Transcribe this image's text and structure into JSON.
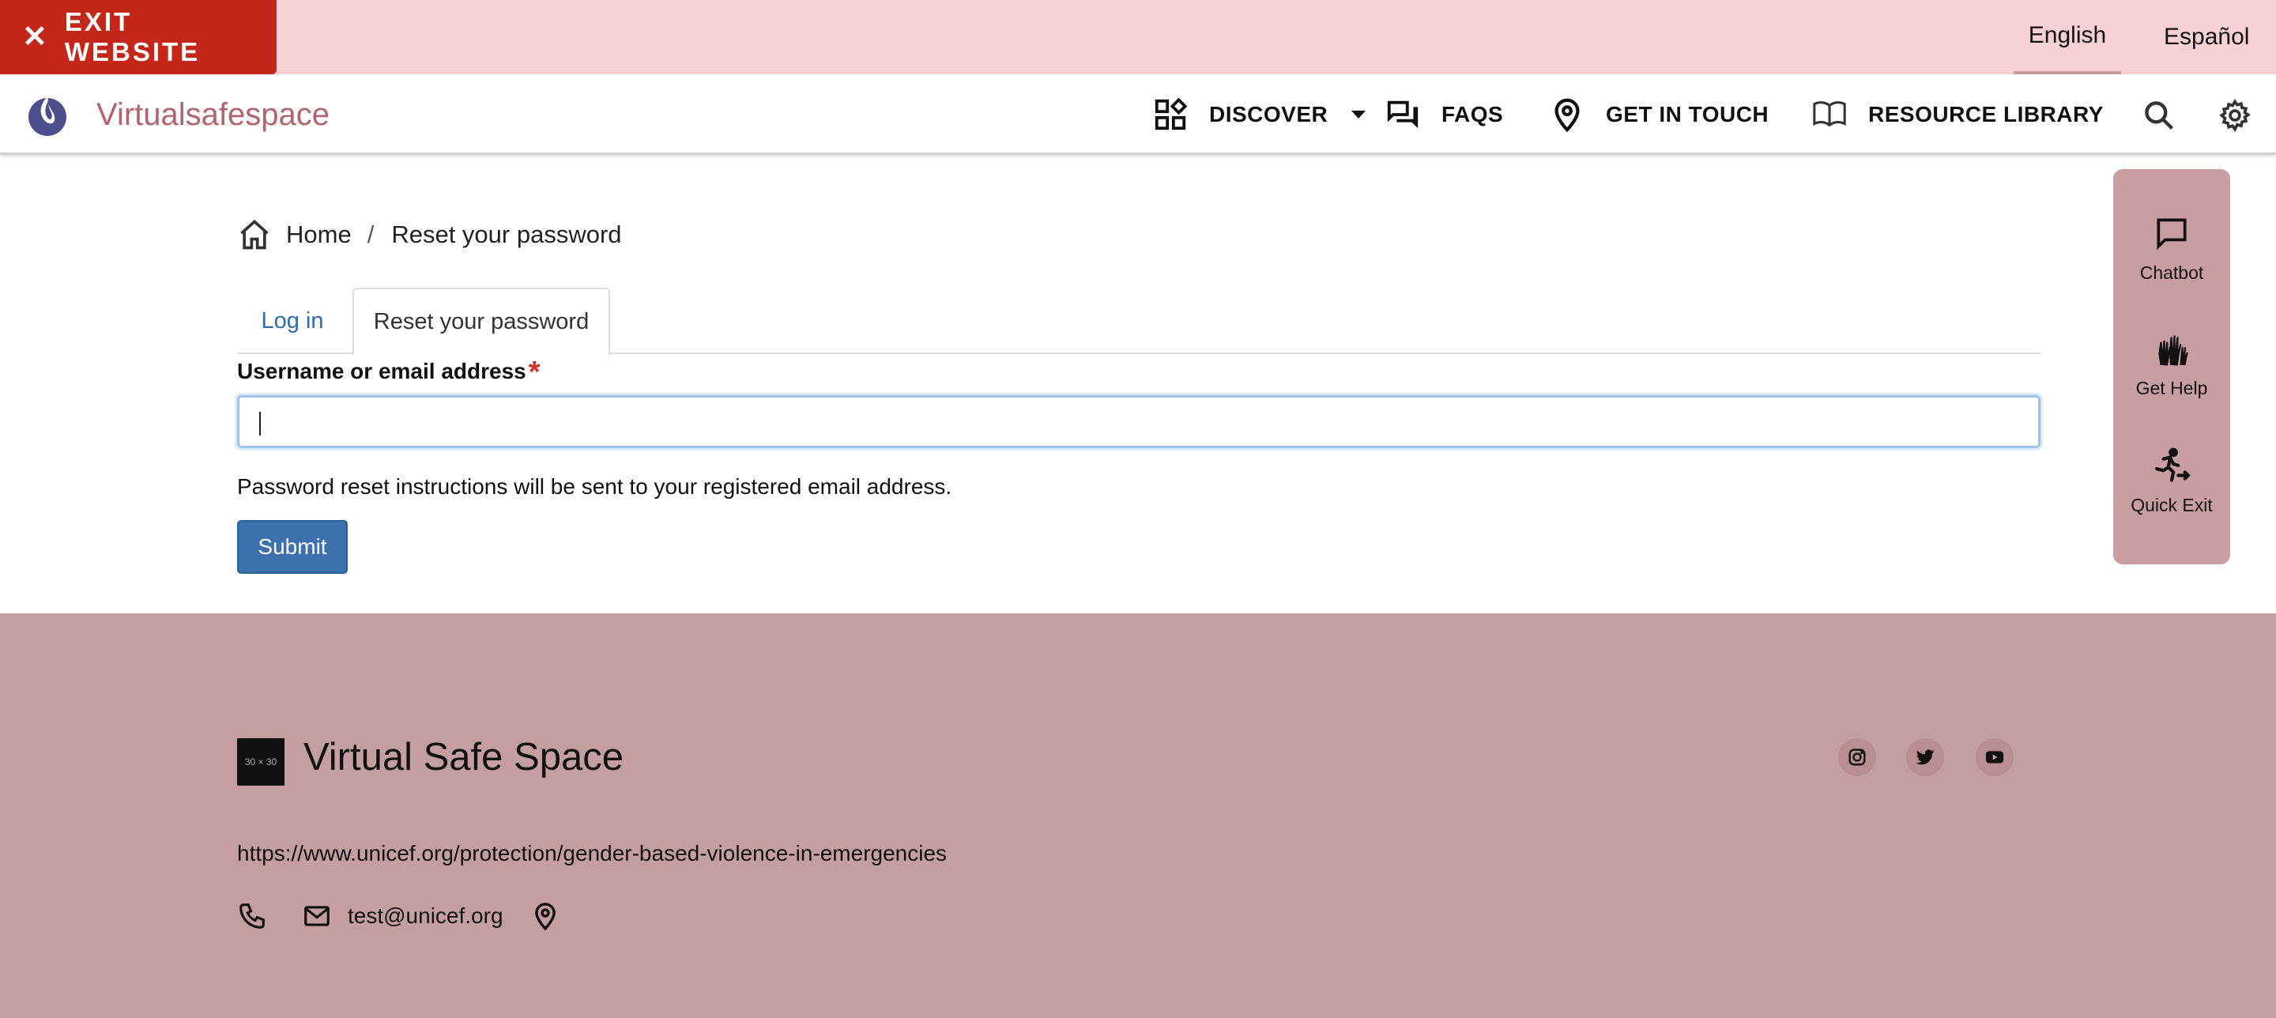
{
  "topbar": {
    "exit_label": "EXIT WEBSITE",
    "languages": [
      "English",
      "Español"
    ],
    "active_language": "English"
  },
  "header": {
    "brand": "Virtualsafespace",
    "nav": {
      "discover": "DISCOVER",
      "faqs": "FAQS",
      "get_in_touch": "GET IN TOUCH",
      "resource_library": "RESOURCE LIBRARY"
    }
  },
  "breadcrumb": {
    "home": "Home",
    "separator": "/",
    "current": "Reset your password"
  },
  "tabs": {
    "login": "Log in",
    "reset": "Reset your password"
  },
  "form": {
    "label": "Username or email address",
    "required_mark": "*",
    "value": "",
    "help": "Password reset instructions will be sent to your registered email address.",
    "submit": "Submit"
  },
  "side_panel": {
    "chatbot": "Chatbot",
    "get_help": "Get Help",
    "quick_exit": "Quick Exit"
  },
  "footer": {
    "logo_text": "30 × 30",
    "title": "Virtual Safe Space",
    "url": "https://www.unicef.org/protection/gender-based-violence-in-emergencies",
    "email": "test@unicef.org"
  },
  "colors": {
    "topbar_bg": "#f7d0d5",
    "exit_bg": "#c4271a",
    "brand": "#b0646f",
    "link": "#2b6cb0",
    "submit_bg": "#3c71ad",
    "side_bg": "#c89ea3",
    "footer_bg": "#c49ea1"
  }
}
